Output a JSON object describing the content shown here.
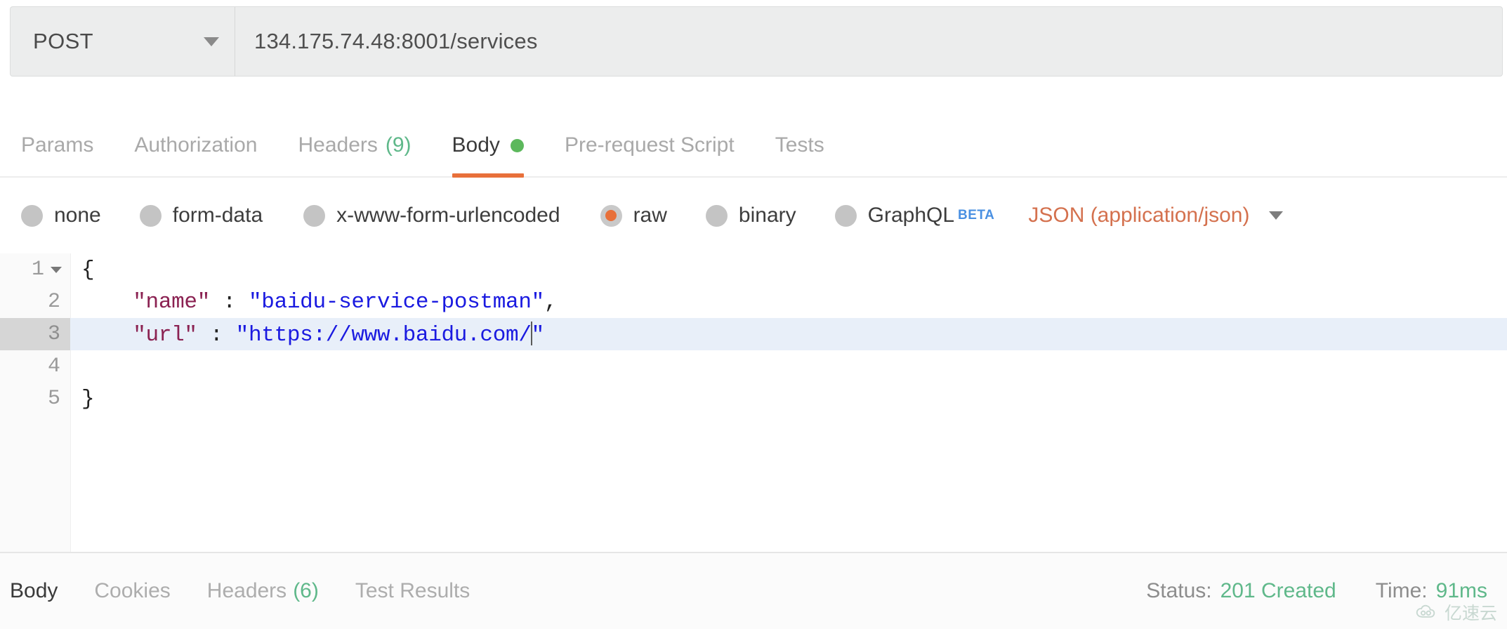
{
  "request": {
    "method": "POST",
    "method_caret_icon": "chevron-down-icon",
    "url": "134.175.74.48:8001/services"
  },
  "request_tabs": [
    {
      "label": "Params",
      "count": "",
      "active": false,
      "dot": false
    },
    {
      "label": "Authorization",
      "count": "",
      "active": false,
      "dot": false
    },
    {
      "label": "Headers",
      "count": "(9)",
      "active": false,
      "dot": false
    },
    {
      "label": "Body",
      "count": "",
      "active": true,
      "dot": true
    },
    {
      "label": "Pre-request Script",
      "count": "",
      "active": false,
      "dot": false
    },
    {
      "label": "Tests",
      "count": "",
      "active": false,
      "dot": false
    }
  ],
  "body_types": [
    {
      "label": "none",
      "selected": false,
      "badge": ""
    },
    {
      "label": "form-data",
      "selected": false,
      "badge": ""
    },
    {
      "label": "x-www-form-urlencoded",
      "selected": false,
      "badge": ""
    },
    {
      "label": "raw",
      "selected": true,
      "badge": ""
    },
    {
      "label": "binary",
      "selected": false,
      "badge": ""
    },
    {
      "label": "GraphQL",
      "selected": false,
      "badge": "BETA"
    }
  ],
  "content_type": {
    "label": "JSON (application/json)",
    "caret_icon": "chevron-down-icon"
  },
  "editor": {
    "lines": [
      {
        "num": "1",
        "fold": true,
        "active": false,
        "indent": "",
        "tokens": [
          {
            "t": "{",
            "c": "punc"
          }
        ]
      },
      {
        "num": "2",
        "fold": false,
        "active": false,
        "indent": "    ",
        "tokens": [
          {
            "t": "\"name\"",
            "c": "key"
          },
          {
            "t": " : ",
            "c": "punc"
          },
          {
            "t": "\"baidu-service-postman\"",
            "c": "str"
          },
          {
            "t": ",",
            "c": "punc"
          }
        ]
      },
      {
        "num": "3",
        "fold": false,
        "active": true,
        "indent": "    ",
        "tokens": [
          {
            "t": "\"url\"",
            "c": "key"
          },
          {
            "t": " : ",
            "c": "punc"
          },
          {
            "t": "\"https://www.baidu.com/",
            "c": "str"
          },
          {
            "t": "__CURSOR__",
            "c": "cursor"
          },
          {
            "t": "\"",
            "c": "str"
          }
        ]
      },
      {
        "num": "4",
        "fold": false,
        "active": false,
        "indent": "",
        "tokens": []
      },
      {
        "num": "5",
        "fold": false,
        "active": false,
        "indent": "",
        "tokens": [
          {
            "t": "}",
            "c": "punc"
          }
        ]
      }
    ]
  },
  "response_tabs": [
    {
      "label": "Body",
      "count": "",
      "active": true
    },
    {
      "label": "Cookies",
      "count": "",
      "active": false
    },
    {
      "label": "Headers",
      "count": "(6)",
      "active": false
    },
    {
      "label": "Test Results",
      "count": "",
      "active": false
    }
  ],
  "response_meta": [
    {
      "key": "Status:",
      "value": "201 Created"
    },
    {
      "key": "Time:",
      "value": "91ms"
    }
  ],
  "watermark": {
    "text": "亿速云",
    "icon": "cloud-icon"
  },
  "colors": {
    "accent_orange": "#e8703a",
    "content_type_orange": "#d4714e",
    "status_green": "#5fb88a",
    "body_dot_green": "#5cb85c",
    "beta_blue": "#4a90e2",
    "json_key": "#8b2252",
    "json_string": "#1a1ae0",
    "active_line": "#e8eff9"
  }
}
